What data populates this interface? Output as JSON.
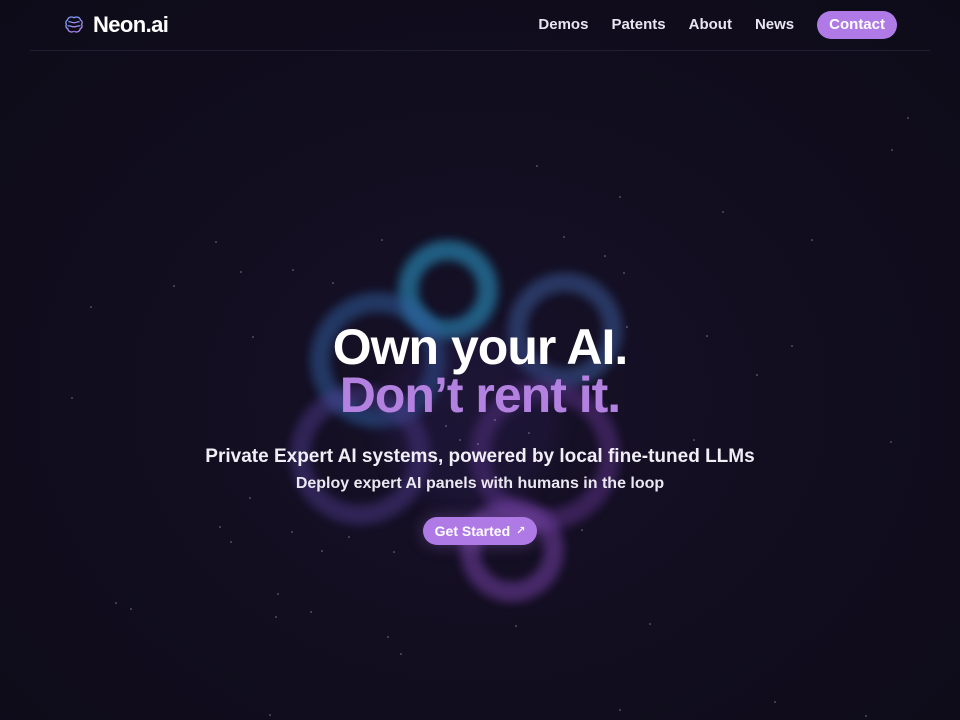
{
  "brand": {
    "name": "Neon.ai",
    "icon": "brain-icon"
  },
  "nav": {
    "links": [
      "Demos",
      "Patents",
      "About",
      "News"
    ],
    "contact_label": "Contact"
  },
  "hero": {
    "headline_line1": "Own your AI.",
    "headline_line2": "Don’t rent it.",
    "tagline": "Private Expert AI systems, powered by local fine-tuned LLMs",
    "subtagline": "Deploy expert AI panels with humans in the loop",
    "cta_label": "Get Started",
    "cta_icon": "arrow-up-right-icon"
  },
  "colors": {
    "background": "#100c1c",
    "accent": "#b07ae6",
    "headline_accent": "#b381e0",
    "glow_blue": "#2fa4d6",
    "glow_purple": "#9a55d8"
  }
}
